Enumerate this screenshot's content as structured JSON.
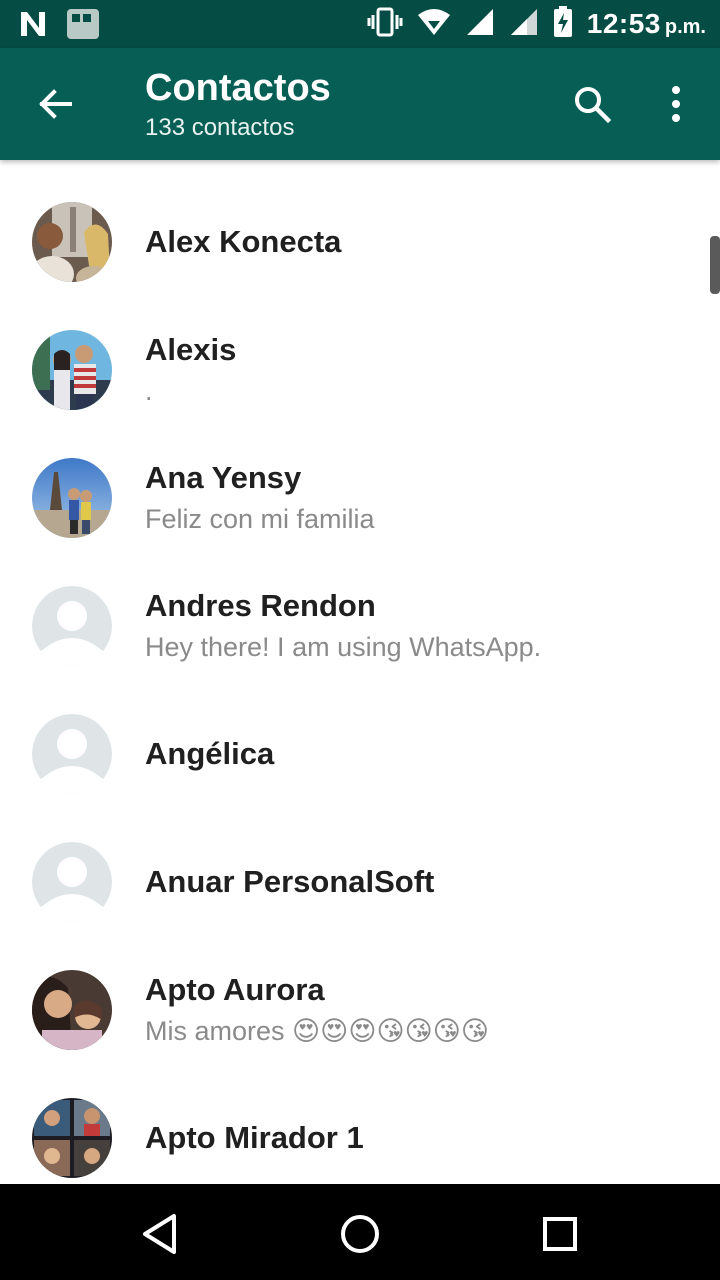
{
  "status_bar": {
    "time": "12:53",
    "ampm": "p.m.",
    "icons": [
      "notification-n-icon",
      "gallery-icon",
      "vibrate-icon",
      "wifi-icon",
      "signal-icon",
      "signal-icon",
      "battery-charging-icon"
    ]
  },
  "app_bar": {
    "title": "Contactos",
    "subtitle": "133 contactos",
    "color": "#075e54",
    "status_color": "#054d44"
  },
  "contacts": [
    {
      "name": "Alex Konecta",
      "status": "",
      "avatar": "photo"
    },
    {
      "name": "Alexis",
      "status": ".",
      "avatar": "photo"
    },
    {
      "name": "Ana Yensy",
      "status": "Feliz con mi familia",
      "avatar": "photo"
    },
    {
      "name": "Andres Rendon",
      "status": "Hey there! I am using WhatsApp.",
      "avatar": "default"
    },
    {
      "name": "Angélica",
      "status": "",
      "avatar": "default"
    },
    {
      "name": "Anuar PersonalSoft",
      "status": "",
      "avatar": "default"
    },
    {
      "name": "Apto Aurora",
      "status": "Mis amores 😍😍😍😘😘😘😘",
      "avatar": "photo"
    },
    {
      "name": "Apto Mirador 1",
      "status": "",
      "avatar": "photo"
    }
  ],
  "nav_bar": {
    "icons": [
      "back-triangle-icon",
      "home-circle-icon",
      "recents-square-icon"
    ]
  }
}
